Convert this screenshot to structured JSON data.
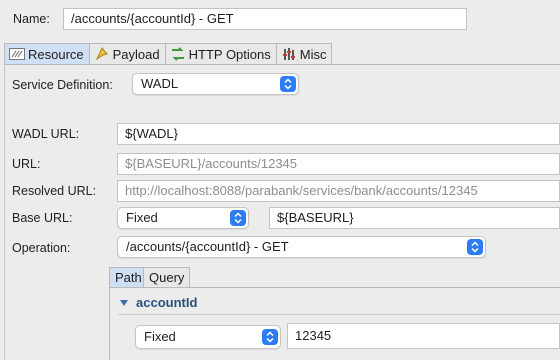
{
  "name": {
    "label": "Name:",
    "value": "/accounts/{accountId} - GET"
  },
  "tabs": [
    {
      "label": "Resource",
      "icon": "resource-icon"
    },
    {
      "label": "Payload",
      "icon": "payload-icon"
    },
    {
      "label": "HTTP Options",
      "icon": "http-options-icon"
    },
    {
      "label": "Misc",
      "icon": "misc-icon"
    }
  ],
  "service_definition": {
    "label": "Service Definition:",
    "value": "WADL"
  },
  "wadl_url": {
    "label": "WADL URL:",
    "value": "${WADL}"
  },
  "url": {
    "label": "URL:",
    "value": "${BASEURL}/accounts/12345"
  },
  "resolved_url": {
    "label": "Resolved URL:",
    "value": "http://localhost:8088/parabank/services/bank/accounts/12345"
  },
  "base_url": {
    "label": "Base URL:",
    "mode": "Fixed",
    "value": "${BASEURL}"
  },
  "operation": {
    "label": "Operation:",
    "value": "/accounts/{accountId} - GET"
  },
  "subtabs": [
    {
      "label": "Path"
    },
    {
      "label": "Query"
    }
  ],
  "param": {
    "name": "accountId",
    "mode": "Fixed",
    "value": "12345"
  },
  "colors": {
    "accent": "#2c7cf6",
    "active_tab": "#cfe0f5"
  }
}
